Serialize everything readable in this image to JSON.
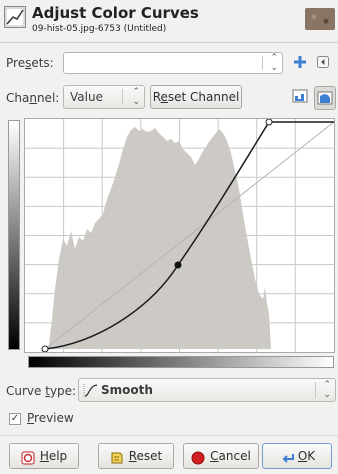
{
  "header": {
    "title": "Adjust Color Curves",
    "subtitle": "09-hist-05.jpg-6753 (Untitled)"
  },
  "presets": {
    "label_pre": "Pre",
    "label_accel": "s",
    "label_post": "ets:",
    "value": ""
  },
  "channel": {
    "label_pre": "Cha",
    "label_accel": "n",
    "label_post": "nel:",
    "value": "Value",
    "reset_pre": "R",
    "reset_accel": "e",
    "reset_post": "set Channel"
  },
  "curve_type": {
    "label_pre": "Curve ",
    "label_accel": "t",
    "label_post": "ype:",
    "value": "Smooth"
  },
  "preview": {
    "label_accel": "P",
    "label_post": "review",
    "checked": true
  },
  "buttons": {
    "help_accel": "H",
    "help_post": "elp",
    "reset_accel": "R",
    "reset_post": "eset",
    "cancel_accel": "C",
    "cancel_post": "ancel",
    "ok_accel": "O",
    "ok_post": "K"
  },
  "colors": {
    "accent": "#3d7fd1",
    "histogram": "#cdc9c4",
    "cancel_red": "#d21f1f"
  },
  "icons": [
    "curves-dialog-icon",
    "image-thumbnail",
    "add-preset-icon",
    "preset-menu-icon",
    "linear-histogram-icon",
    "log-histogram-icon",
    "smooth-curve-icon",
    "help-icon",
    "reset-icon",
    "cancel-icon",
    "ok-icon"
  ]
}
